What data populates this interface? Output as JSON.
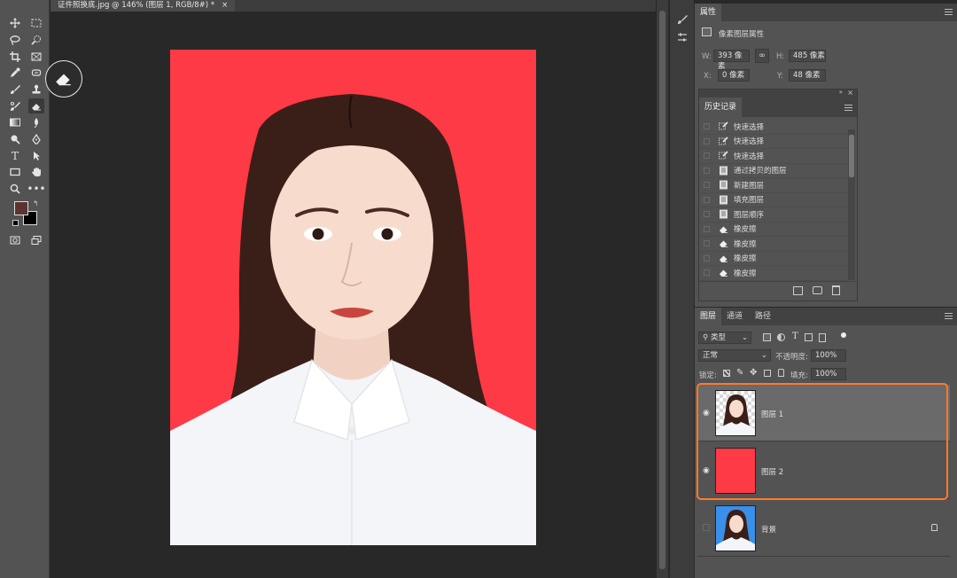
{
  "document": {
    "tab_title": "证件照换底.jpg @ 146% (图层 1, RGB/8#) *",
    "tab_close": "×"
  },
  "colors": {
    "photo_background": "#fd3a45",
    "foreground_swatch": "#5a3430",
    "background_swatch": "#000000",
    "blue_background": "#3a8fe8",
    "highlight_border": "#ff7a2a"
  },
  "toolbar": {
    "tools": [
      "move-tool-icon",
      "marquee-tool-icon",
      "lasso-tool-icon",
      "quick-selection-tool-icon",
      "crop-tool-icon",
      "frame-tool-icon",
      "eyedropper-tool-icon",
      "healing-brush-icon",
      "brush-tool-icon",
      "clone-stamp-icon",
      "history-brush-icon",
      "eraser-tool-icon",
      "gradient-tool-icon",
      "blur-tool-icon",
      "dodge-tool-icon",
      "pen-tool-icon",
      "type-tool-icon",
      "path-selection-icon",
      "rectangle-tool-icon",
      "hand-tool-icon",
      "zoom-tool-icon",
      "more-tools-icon"
    ],
    "active_tool": "eraser-tool-icon",
    "type_glyph": "T"
  },
  "properties": {
    "tab_label": "属性",
    "section_label": "像素图层属性",
    "w_label": "W:",
    "w_value": "393 像素",
    "h_label": "H:",
    "h_value": "485 像素",
    "x_label": "X:",
    "x_value": "0 像素",
    "y_label": "Y:",
    "y_value": "48 像素"
  },
  "history": {
    "tab_label": "历史记录",
    "items": [
      {
        "label": "快速选择",
        "icon": "quick-selection-icon"
      },
      {
        "label": "快速选择",
        "icon": "quick-selection-icon"
      },
      {
        "label": "快速选择",
        "icon": "quick-selection-icon"
      },
      {
        "label": "通过拷贝的图层",
        "icon": "layer-document-icon"
      },
      {
        "label": "新建图层",
        "icon": "layer-document-icon"
      },
      {
        "label": "填充图层",
        "icon": "layer-document-icon"
      },
      {
        "label": "图层顺序",
        "icon": "layer-document-icon"
      },
      {
        "label": "橡皮擦",
        "icon": "eraser-icon"
      },
      {
        "label": "橡皮擦",
        "icon": "eraser-icon"
      },
      {
        "label": "橡皮擦",
        "icon": "eraser-icon"
      },
      {
        "label": "橡皮擦",
        "icon": "eraser-icon"
      }
    ]
  },
  "layers_panel": {
    "tabs": [
      "图层",
      "通道",
      "路径"
    ],
    "active_tab": "图层",
    "filter_label": "类型",
    "blend_mode": "正常",
    "opacity_label": "不透明度:",
    "opacity_value": "100%",
    "lock_label": "锁定:",
    "fill_label": "填充:",
    "fill_value": "100%",
    "layers": [
      {
        "name": "图层 1",
        "visible": true,
        "selected": true,
        "thumbnail": "portrait-transparent"
      },
      {
        "name": "图层 2",
        "visible": true,
        "selected": false,
        "thumbnail": "solid-red"
      },
      {
        "name": "背景",
        "visible": false,
        "selected": false,
        "thumbnail": "portrait-blue",
        "locked": true
      }
    ]
  }
}
